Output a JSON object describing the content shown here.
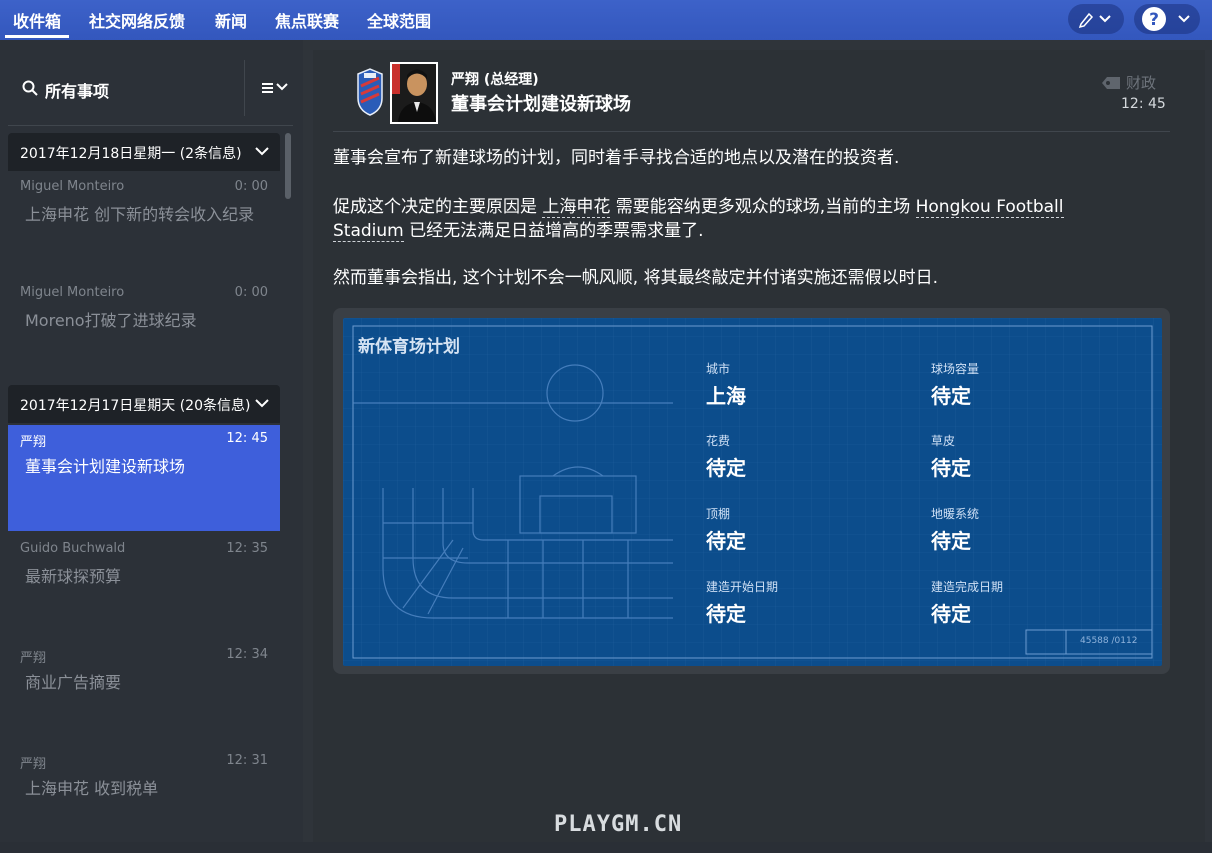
{
  "top_nav": {
    "tabs": [
      "收件箱",
      "社交网络反馈",
      "新闻",
      "焦点联赛",
      "全球范围"
    ],
    "active_tab": "收件箱",
    "right_buttons": [
      "pencil-icon",
      "help-icon"
    ]
  },
  "sidebar": {
    "filter_label": "所有事项",
    "groups": [
      {
        "header": "2017年12月18日星期一 (2条信息)",
        "messages": [
          {
            "from": "Miguel Monteiro",
            "time": "0: 00",
            "subject": "上海申花 创下新的转会收入纪录"
          },
          {
            "from": "Miguel Monteiro",
            "time": "0: 00",
            "subject": "Moreno打破了进球纪录"
          }
        ]
      },
      {
        "header": "2017年12月17日星期天 (20条信息)",
        "messages": [
          {
            "from": "严翔",
            "time": "12: 45",
            "subject": "董事会计划建设新球场",
            "selected": true
          },
          {
            "from": "Guido Buchwald",
            "time": "12: 35",
            "subject": "最新球探预算"
          },
          {
            "from": "严翔",
            "time": "12: 34",
            "subject": "商业广告摘要"
          },
          {
            "from": "严翔",
            "time": "12: 31",
            "subject": "上海申花 收到税单"
          }
        ]
      }
    ]
  },
  "message": {
    "sender": "严翔 (总经理)",
    "subject": "董事会计划建设新球场",
    "category": "财政",
    "time": "12: 45",
    "paragraphs": {
      "p1": "董事会宣布了新建球场的计划，同时着手寻找合适的地点以及潜在的投资者.",
      "p2_a": "促成这个决定的主要原因是 ",
      "p2_link1": "上海申花",
      "p2_b": " 需要能容纳更多观众的球场,当前的主场 ",
      "p2_link2a": "Hongkou Football",
      "p2_link2b": "Stadium",
      "p2_c": " 已经无法满足日益增高的季票需求量了.",
      "p3": "然而董事会指出, 这个计划不会一帆风顺, 将其最终敲定并付诸实施还需假以时日."
    }
  },
  "stadium_plan": {
    "title": "新体育场计划",
    "stamp": "45588 /0112",
    "fields": [
      {
        "label": "城市",
        "value": "上海"
      },
      {
        "label": "球场容量",
        "value": "待定"
      },
      {
        "label": "花费",
        "value": "待定"
      },
      {
        "label": "草皮",
        "value": "待定"
      },
      {
        "label": "顶棚",
        "value": "待定"
      },
      {
        "label": "地暖系统",
        "value": "待定"
      },
      {
        "label": "建造开始日期",
        "value": "待定"
      },
      {
        "label": "建造完成日期",
        "value": "待定"
      }
    ]
  },
  "watermark": "PLAYGM.CN",
  "colors": {
    "topbar": "#3d62c9",
    "selected": "#3e5fdb",
    "blueprint": "#0c4d8c"
  }
}
